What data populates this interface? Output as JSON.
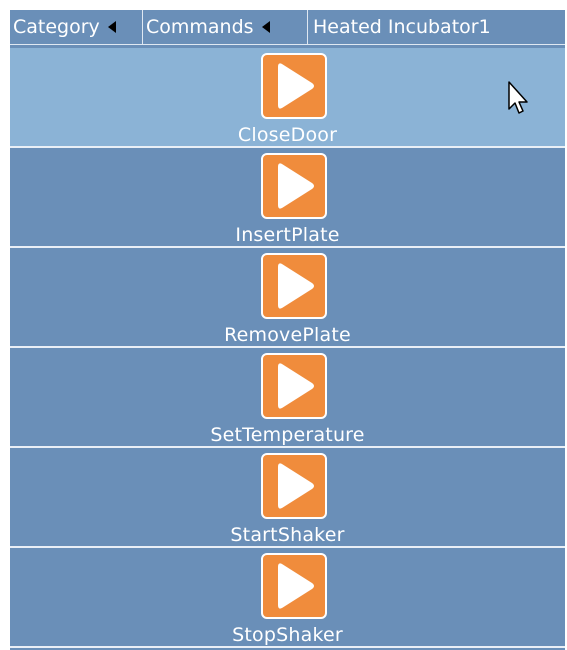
{
  "breadcrumb": {
    "category_label": "Category",
    "commands_label": "Commands",
    "device_label": "Heated Incubator1"
  },
  "colors": {
    "panel_background": "#6a8fb8",
    "selected_row": "#8bb3d6",
    "play_button": "#f08c3c",
    "text": "#ffffff"
  },
  "commands": [
    {
      "label": "CloseDoor",
      "selected": true,
      "icon": "play-icon"
    },
    {
      "label": "InsertPlate",
      "selected": false,
      "icon": "play-icon"
    },
    {
      "label": "RemovePlate",
      "selected": false,
      "icon": "play-icon"
    },
    {
      "label": "SetTemperature",
      "selected": false,
      "icon": "play-icon"
    },
    {
      "label": "StartShaker",
      "selected": false,
      "icon": "play-icon"
    },
    {
      "label": "StopShaker",
      "selected": false,
      "icon": "play-icon"
    }
  ]
}
